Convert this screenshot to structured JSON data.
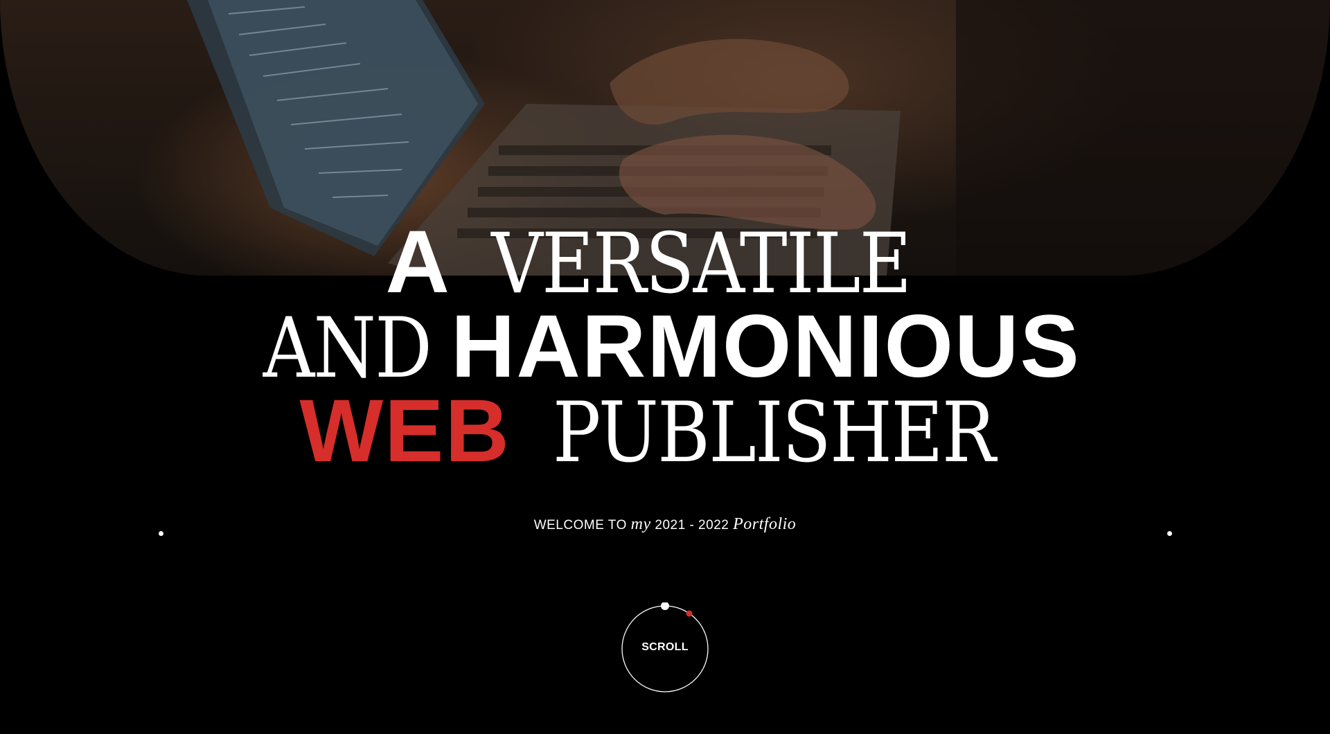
{
  "hero": {
    "line1": {
      "sans": "A",
      "serif": "VERSATILE"
    },
    "line2": {
      "serif": "AND",
      "sans": "HARMONIOUS"
    },
    "line3": {
      "accent": "WEB",
      "serif": "PUBLISHER"
    },
    "accent_color": "#d62e2b"
  },
  "tagline": {
    "prefix": "WELCOME TO",
    "italic_my": "my",
    "years": "2021 - 2022",
    "italic_portfolio": "Portfolio"
  },
  "scroll": {
    "label": "SCROLL"
  },
  "icons": {
    "scroll_indicator": "circle-scroll-icon"
  }
}
